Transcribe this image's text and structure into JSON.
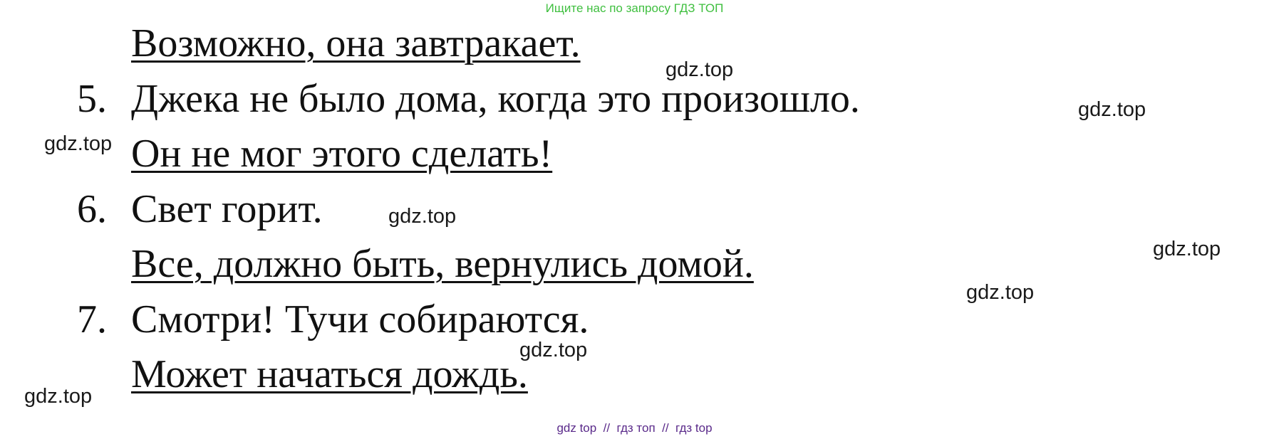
{
  "header": {
    "note": "Ищите нас по запросу ГДЗ ТОП",
    "note_color": "#3fbf3f"
  },
  "exercise": {
    "lines": [
      {
        "number": "",
        "text": "Возможно, она завтракает.",
        "underlined": true
      },
      {
        "number": "5.",
        "text": "Джека не было дома, когда это произошло.",
        "underlined": false
      },
      {
        "number": "",
        "text": "Он не мог этого сделать!",
        "underlined": true
      },
      {
        "number": "6.",
        "text": "Свет горит.",
        "underlined": false
      },
      {
        "number": "",
        "text": "Все, должно быть, вернулись домой.",
        "underlined": true
      },
      {
        "number": "7.",
        "text": "Смотри! Тучи собираются.",
        "underlined": false
      },
      {
        "number": "",
        "text": "Может начаться дождь.",
        "underlined": true
      }
    ]
  },
  "watermarks": [
    "gdz.top",
    "gdz.top",
    "gdz.top",
    "gdz.top",
    "gdz.top",
    "gdz.top",
    "gdz.top",
    "gdz.top"
  ],
  "footer": {
    "text": "gdz top  //  гдз топ  //  гдз top",
    "color": "#5a2a8a"
  }
}
